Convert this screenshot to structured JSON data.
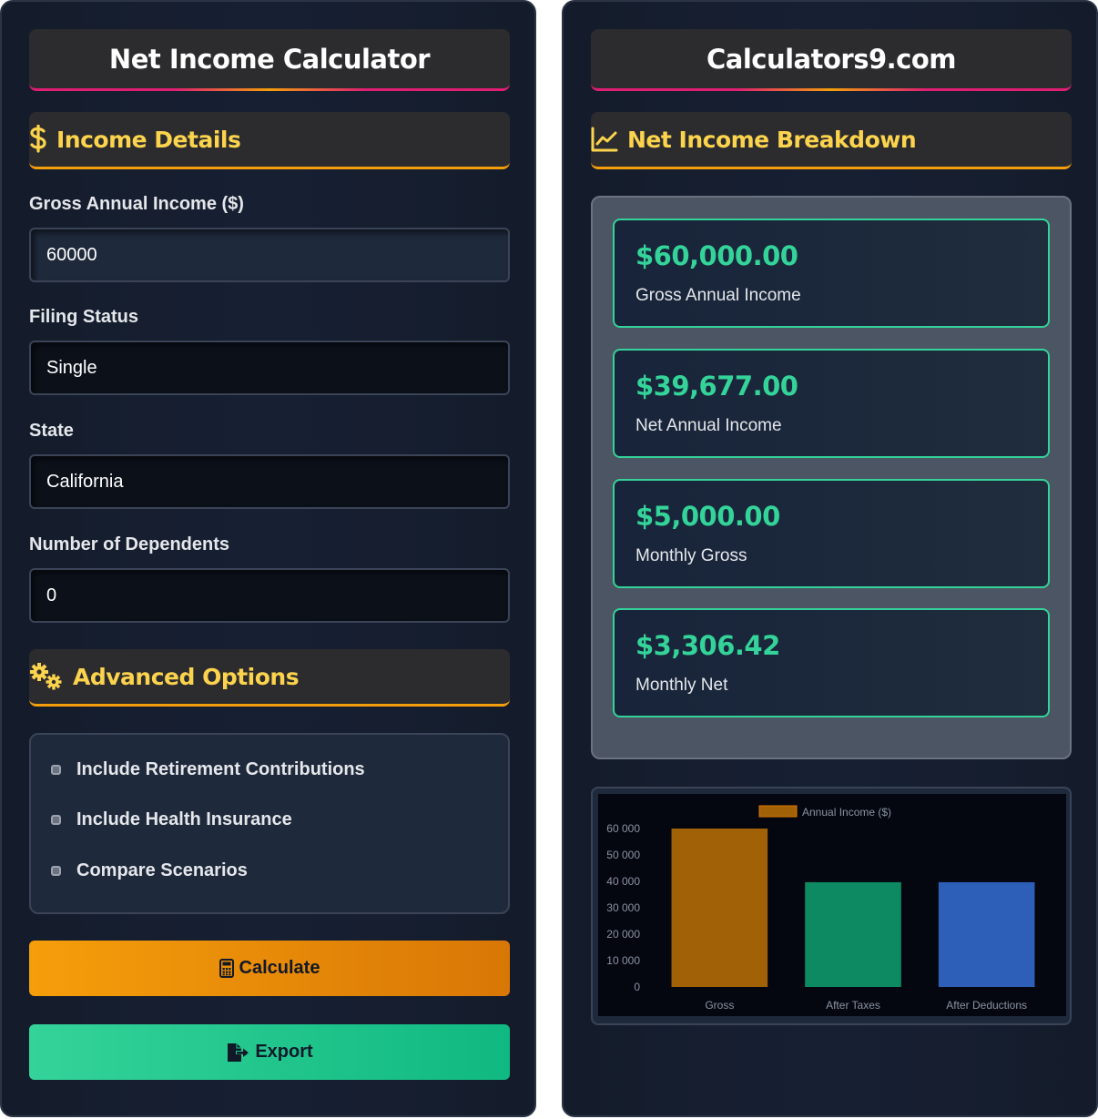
{
  "left": {
    "title": "Net Income Calculator",
    "income_section": "Income Details",
    "gross_label": "Gross Annual Income ($)",
    "gross_value": "60000",
    "filing_label": "Filing Status",
    "filing_value": "Single",
    "state_label": "State",
    "state_value": "California",
    "dependents_label": "Number of Dependents",
    "dependents_value": "0",
    "advanced_section": "Advanced Options",
    "options": [
      "Include Retirement Contributions",
      "Include Health Insurance",
      "Compare Scenarios"
    ],
    "calculate_label": "Calculate",
    "export_label": "Export"
  },
  "right": {
    "title": "Calculators9.com",
    "breakdown_section": "Net Income Breakdown",
    "cards": [
      {
        "value": "$60,000.00",
        "label": "Gross Annual Income"
      },
      {
        "value": "$39,677.00",
        "label": "Net Annual Income"
      },
      {
        "value": "$5,000.00",
        "label": "Monthly Gross"
      },
      {
        "value": "$3,306.42",
        "label": "Monthly Net"
      }
    ]
  },
  "colors": {
    "accent_gold": "#fcd34d",
    "accent_green": "#34d399",
    "accent_pink": "#e11d74",
    "calc_button": "#f59e0b",
    "export_button": "#10b981"
  },
  "chart_data": {
    "type": "bar",
    "categories": [
      "Gross",
      "After Taxes",
      "After Deductions"
    ],
    "series": [
      {
        "name": "Annual Income ($)",
        "values": [
          60000,
          39677,
          39677
        ],
        "colors": [
          "#a16207",
          "#0e8a62",
          "#2e5fb8"
        ]
      }
    ],
    "yticks": [
      "0",
      "10 000",
      "20 000",
      "30 000",
      "40 000",
      "50 000",
      "60 000"
    ],
    "ylim": [
      0,
      60000
    ],
    "legend": "top-center",
    "grid": false
  }
}
